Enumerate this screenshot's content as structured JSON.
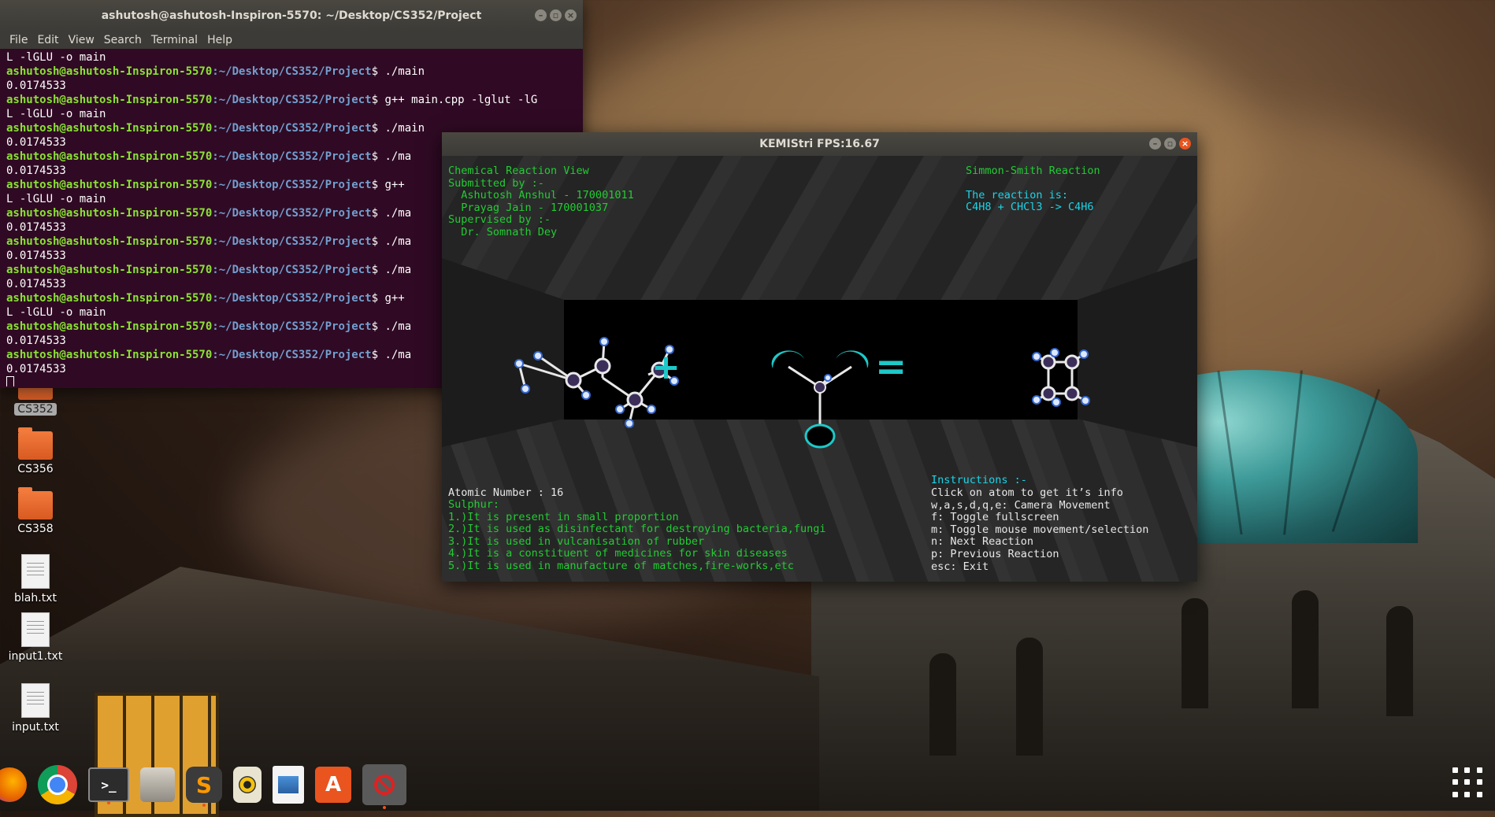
{
  "terminal": {
    "title": "ashutosh@ashutosh-Inspiron-5570: ~/Desktop/CS352/Project",
    "menu": [
      "File",
      "Edit",
      "View",
      "Search",
      "Terminal",
      "Help"
    ],
    "user": "ashutosh@ashutosh-Inspiron-5570",
    "path": ":~/Desktop/CS352/Project",
    "lines": [
      {
        "type": "out",
        "text": "L -lGLU -o main"
      },
      {
        "type": "cmd",
        "text": "$ ./main"
      },
      {
        "type": "out",
        "text": "0.0174533"
      },
      {
        "type": "cmd",
        "text": "$ g++ main.cpp -lglut -lG"
      },
      {
        "type": "out",
        "text": "L -lGLU -o main"
      },
      {
        "type": "cmd",
        "text": "$ ./main"
      },
      {
        "type": "out",
        "text": "0.0174533"
      },
      {
        "type": "cmd",
        "text": "$ ./ma"
      },
      {
        "type": "out",
        "text": "0.0174533"
      },
      {
        "type": "cmd",
        "text": "$ g++"
      },
      {
        "type": "out",
        "text": "L -lGLU -o main"
      },
      {
        "type": "cmd",
        "text": "$ ./ma"
      },
      {
        "type": "out",
        "text": "0.0174533"
      },
      {
        "type": "cmd",
        "text": "$ ./ma"
      },
      {
        "type": "out",
        "text": "0.0174533"
      },
      {
        "type": "cmd",
        "text": "$ ./ma"
      },
      {
        "type": "out",
        "text": "0.0174533"
      },
      {
        "type": "cmd",
        "text": "$ g++"
      },
      {
        "type": "out",
        "text": "L -lGLU -o main"
      },
      {
        "type": "cmd",
        "text": "$ ./ma"
      },
      {
        "type": "out",
        "text": "0.0174533"
      },
      {
        "type": "cmd",
        "text": "$ ./ma"
      },
      {
        "type": "out",
        "text": "0.0174533"
      }
    ]
  },
  "kemistri": {
    "title": "KEMIStri FPS:16.67",
    "header_left": "Chemical Reaction View\nSubmitted by :-\n  Ashutosh Anshul - 170001011\n  Prayag Jain - 170001037\nSupervised by :-\n  Dr. Somnath Dey",
    "reaction_name": "Simmon-Smith Reaction",
    "reaction_label": "The reaction is:",
    "reaction_formula": "C4H8 + CHCl3 -> C4H6",
    "plus_symbol": "+",
    "equals_symbol": "=",
    "atomic_number": "Atomic Number : 16",
    "element_info": "Sulphur:\n1.)It is present in small proportion\n2.)It is used as disinfectant for destroying bacteria,fungi\n3.)It is used in vulcanisation of rubber\n4.)It is a constituent of medicines for skin diseases\n5.)It is used in manufacture of matches,fire-works,etc",
    "instructions_title": "Instructions :-",
    "instructions": "Click on atom to get it’s info\nw,a,s,d,q,e: Camera Movement\nf: Toggle fullscreen\nm: Toggle mouse movement/selection\nn: Next Reaction\np: Previous Reaction\nesc: Exit"
  },
  "desktop_icons": [
    "CS352",
    "CS356",
    "CS358",
    "blah.txt",
    "input1.txt",
    "input.txt"
  ],
  "dock": [
    "firefox-icon",
    "chrome-icon",
    "terminal-icon",
    "files-icon",
    "sublime-icon",
    "rhythmbox-icon",
    "document-viewer-icon",
    "software-center-icon",
    "kemistri-app-icon"
  ],
  "colors": {
    "terminal_bg": "#300a24",
    "prompt_user": "#8ae234",
    "prompt_path": "#729fcf",
    "kem_green": "#22cc33",
    "kem_cyan": "#1ad5e8",
    "molecule_cyan": "#1ec8c8",
    "ubuntu_orange": "#e9541f"
  }
}
